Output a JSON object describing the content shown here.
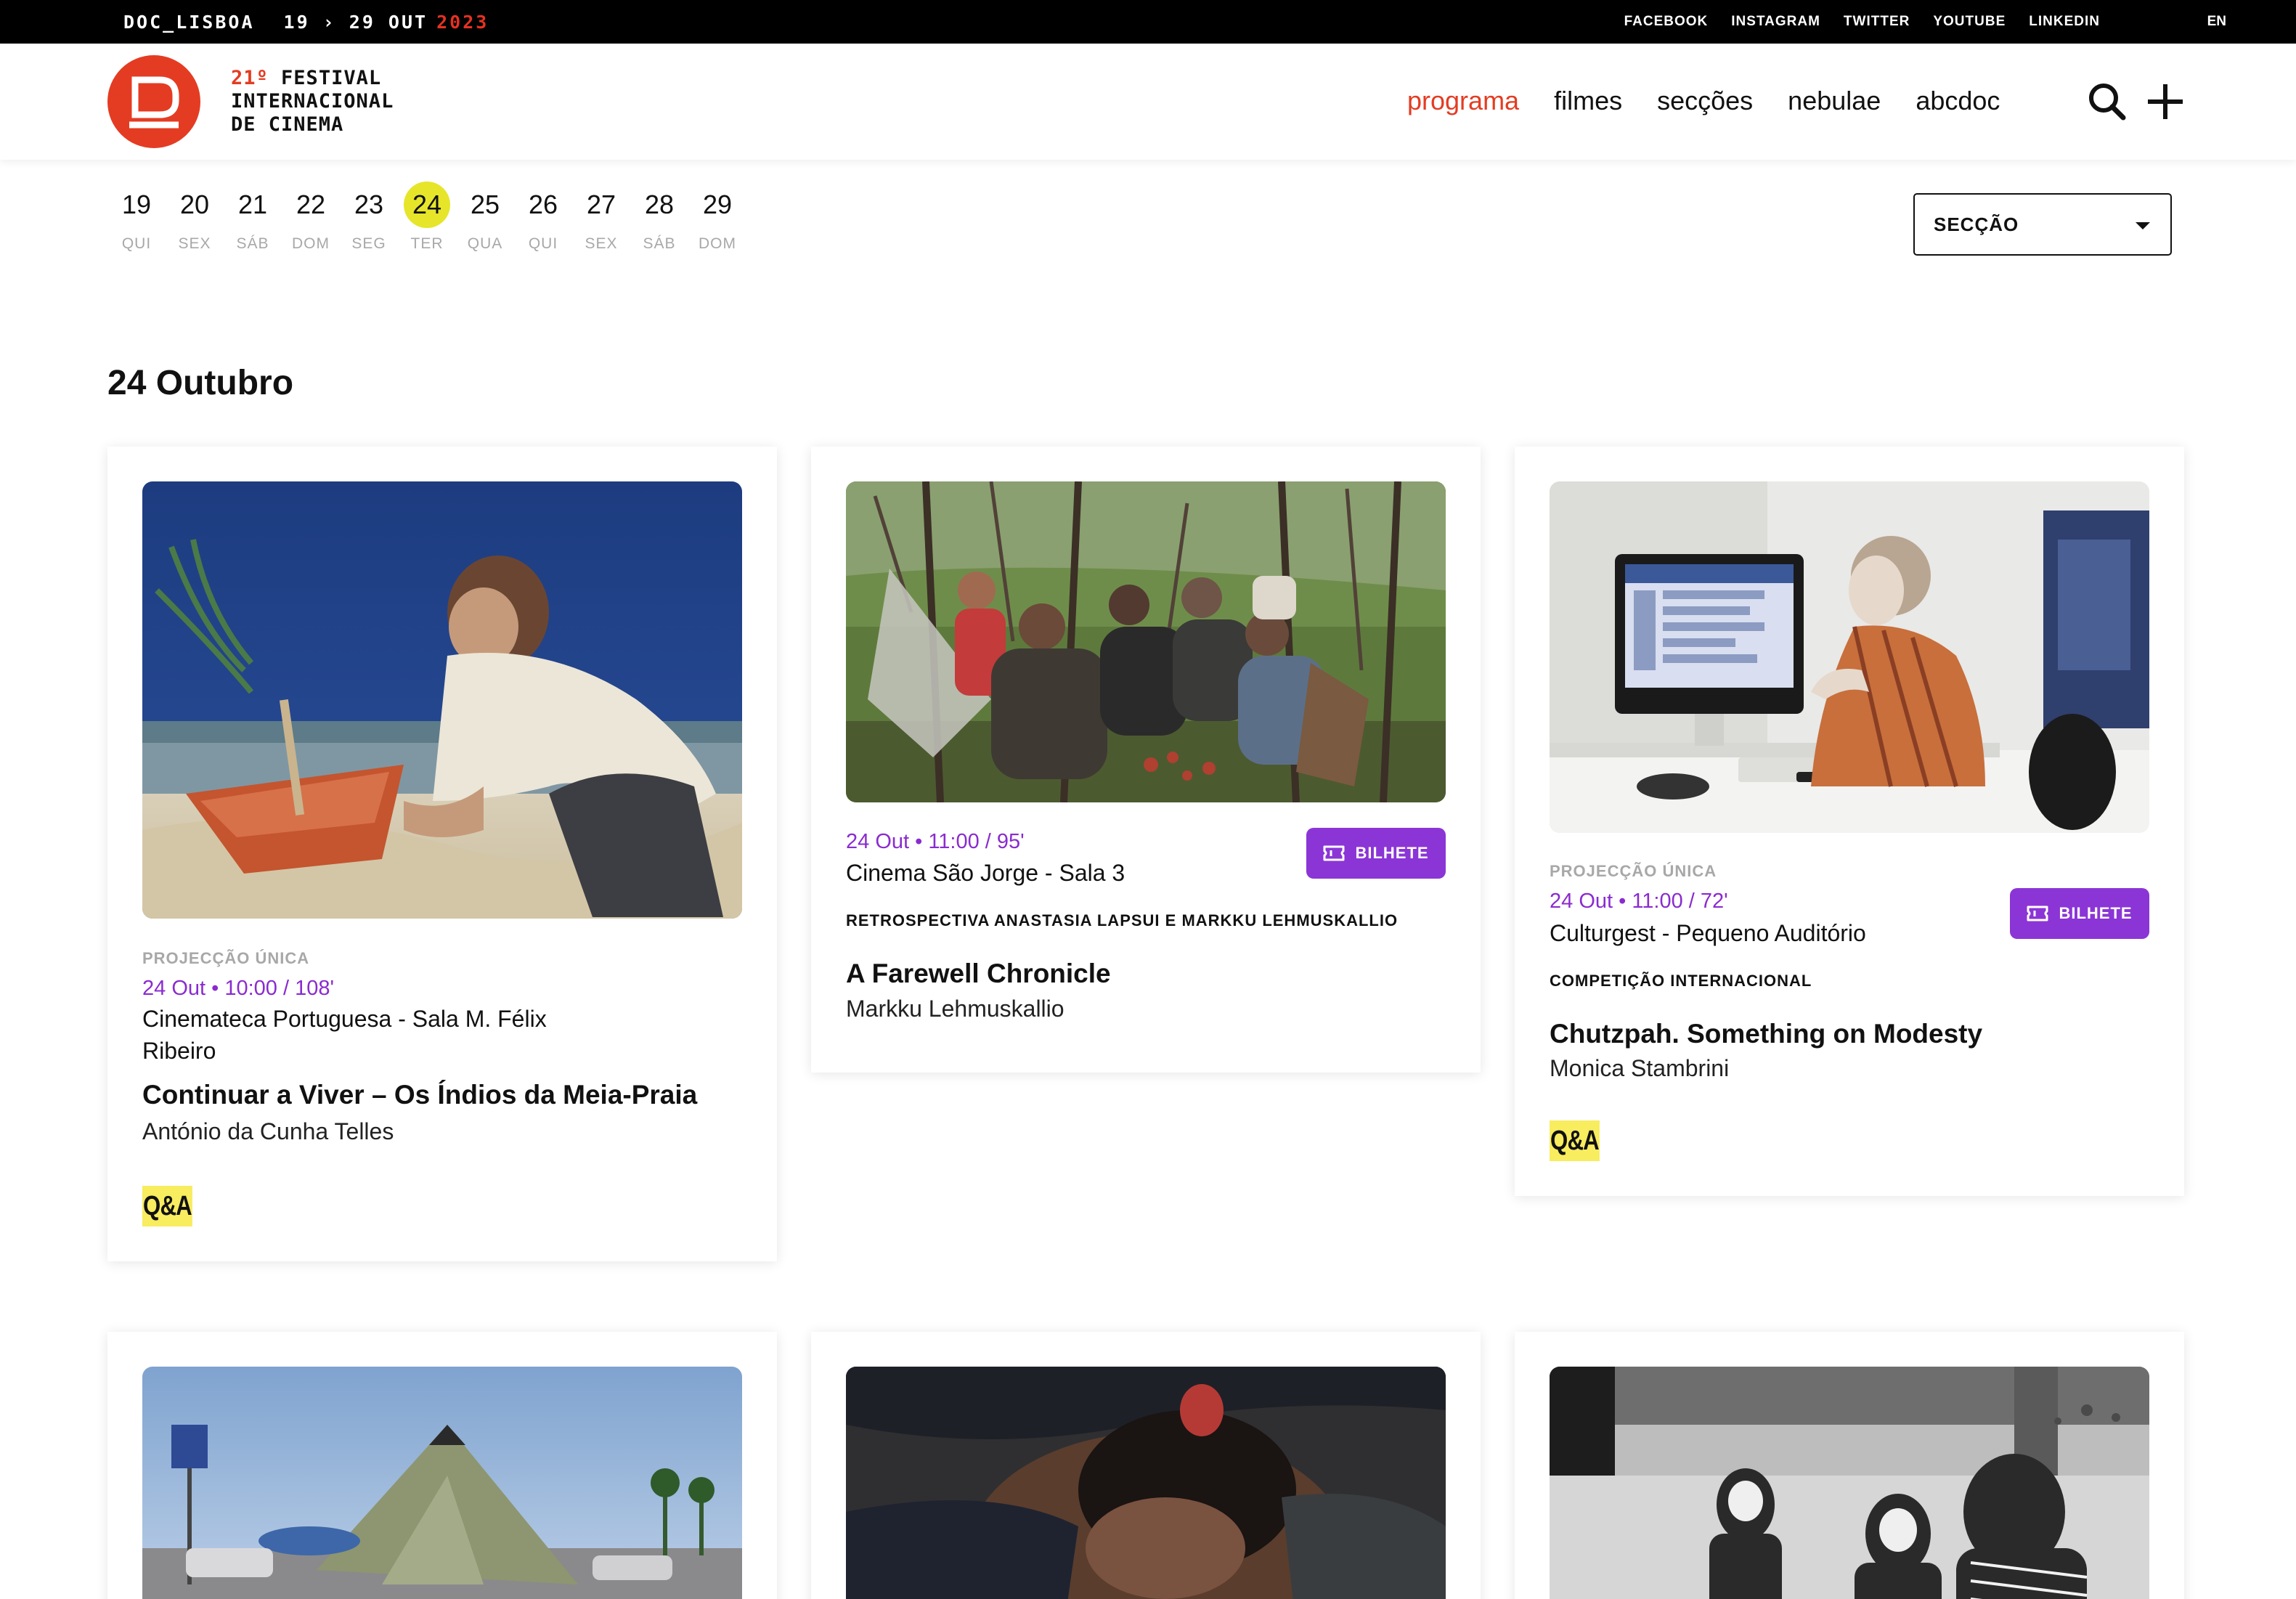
{
  "topbar": {
    "brand": "DOC_LISBOA",
    "dates": "19 › 29 OUT",
    "year": "2023",
    "social": [
      "FACEBOOK",
      "INSTAGRAM",
      "TWITTER",
      "YOUTUBE",
      "LINKEDIN"
    ],
    "language": "EN"
  },
  "header": {
    "logo_number": "21º",
    "logo_line1": "FESTIVAL",
    "logo_line2": "INTERNACIONAL",
    "logo_line3": "DE CINEMA",
    "nav": [
      {
        "label": "programa",
        "active": true
      },
      {
        "label": "filmes"
      },
      {
        "label": "secções"
      },
      {
        "label": "nebulae"
      },
      {
        "label": "abcdoc"
      }
    ]
  },
  "date_strip": {
    "days": [
      {
        "num": "19",
        "dow": "QUI"
      },
      {
        "num": "20",
        "dow": "SEX"
      },
      {
        "num": "21",
        "dow": "SÁB"
      },
      {
        "num": "22",
        "dow": "DOM"
      },
      {
        "num": "23",
        "dow": "SEG"
      },
      {
        "num": "24",
        "dow": "TER",
        "active": true
      },
      {
        "num": "25",
        "dow": "QUA"
      },
      {
        "num": "26",
        "dow": "QUI"
      },
      {
        "num": "27",
        "dow": "SEX"
      },
      {
        "num": "28",
        "dow": "SÁB"
      },
      {
        "num": "29",
        "dow": "DOM"
      }
    ],
    "section_select": "SECÇÃO"
  },
  "day_title": "24 Outubro",
  "cards": [
    {
      "tag": "PROJECÇÃO ÚNICA",
      "when": "24 Out • 10:00 / 108'",
      "venue": "Cinemateca Portuguesa - Sala M. Félix Ribeiro",
      "title": "Continuar a Viver – Os Índios da Meia-Praia",
      "director": "António da Cunha Telles",
      "qa": "Q&A"
    },
    {
      "when": "24 Out • 11:00 / 95'",
      "venue": "Cinema São Jorge - Sala 3",
      "ticket": "BILHETE",
      "section": "RETROSPECTIVA ANASTASIA LAPSUI E MARKKU LEHMUSKALLIO",
      "title": "A Farewell Chronicle",
      "director": "Markku Lehmuskallio"
    },
    {
      "tag": "PROJECÇÃO ÚNICA",
      "when": "24 Out • 11:00 / 72'",
      "venue": "Culturgest - Pequeno Auditório",
      "ticket": "BILHETE",
      "section": "COMPETIÇÃO INTERNACIONAL",
      "title": "Chutzpah. Something on Modesty",
      "director": "Monica Stambrini",
      "qa": "Q&A"
    }
  ],
  "colors": {
    "accent_red": "#e43c22",
    "purple": "#8b35d6",
    "date_highlight": "#e6e52a",
    "qa_yellow": "#f8ec5f"
  }
}
